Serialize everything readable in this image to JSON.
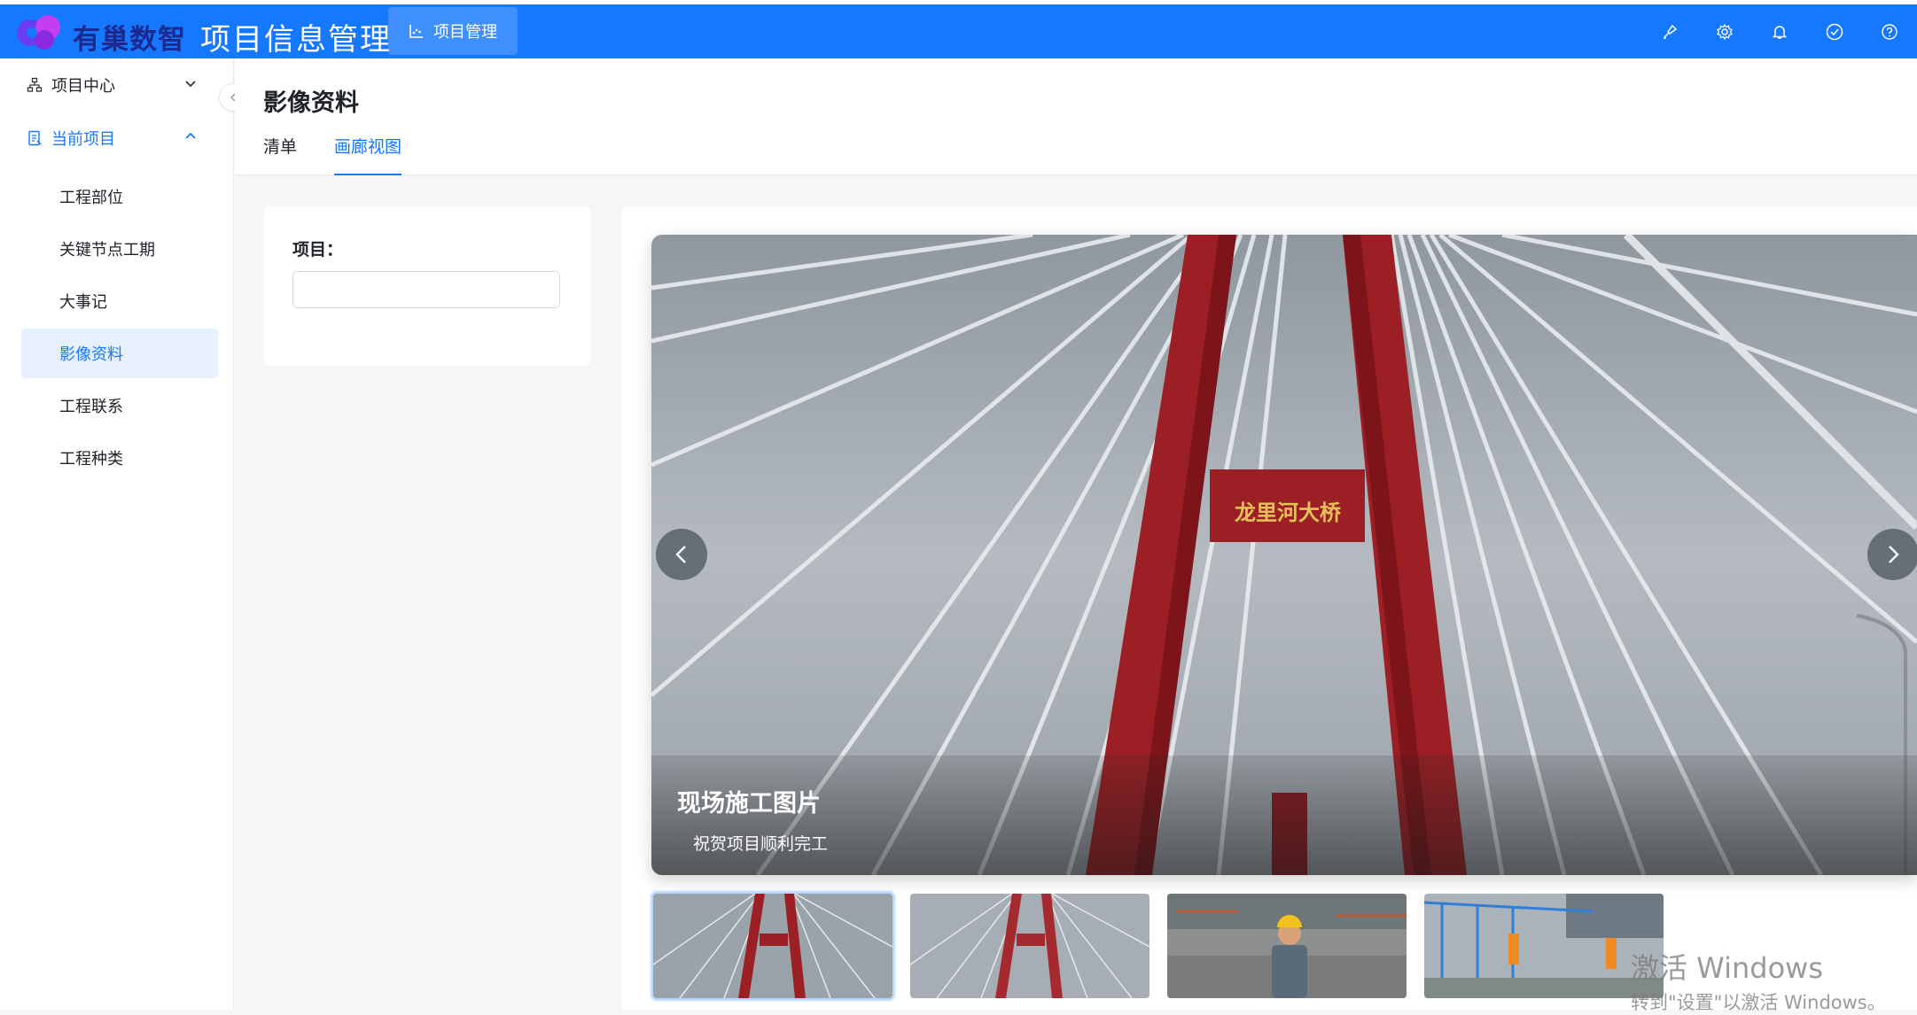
{
  "header": {
    "logo_text": "有巢数智",
    "app_title": "项目信息管理",
    "top_tab_label": "项目管理",
    "icons": [
      "brush-icon",
      "gear-icon",
      "bell-icon",
      "check-circle-icon",
      "help-icon"
    ]
  },
  "sidebar": {
    "groups": [
      {
        "label": "项目中心",
        "icon": "org-tree-icon",
        "expanded": false
      },
      {
        "label": "当前项目",
        "icon": "document-icon",
        "expanded": true
      }
    ],
    "items": [
      {
        "label": "工程部位"
      },
      {
        "label": "关键节点工期"
      },
      {
        "label": "大事记"
      },
      {
        "label": "影像资料",
        "selected": true
      },
      {
        "label": "工程联系"
      },
      {
        "label": "工程种类"
      }
    ]
  },
  "page": {
    "title": "影像资料",
    "tabs": [
      {
        "label": "清单",
        "active": false
      },
      {
        "label": "画廊视图",
        "active": true
      }
    ]
  },
  "filter": {
    "label": "项目：",
    "value": "",
    "placeholder": ""
  },
  "carousel": {
    "caption_title": "现场施工图片",
    "caption_subtitle": "祝贺项目顺利完工",
    "bridge_sign": "龙里河大桥",
    "thumbnails": [
      {
        "subject": "bridge",
        "active": true
      },
      {
        "subject": "bridge",
        "active": false
      },
      {
        "subject": "worker-in-factory",
        "active": false
      },
      {
        "subject": "site-workers",
        "active": false
      }
    ]
  },
  "watermark": {
    "line1": "激活 Windows",
    "line2": "转到\"设置\"以激活 Windows。"
  },
  "colors": {
    "primary": "#1677ff",
    "topbar": "#1677ff",
    "selected_bg": "#e6f0ff",
    "tower_red": "#9b1f24"
  }
}
